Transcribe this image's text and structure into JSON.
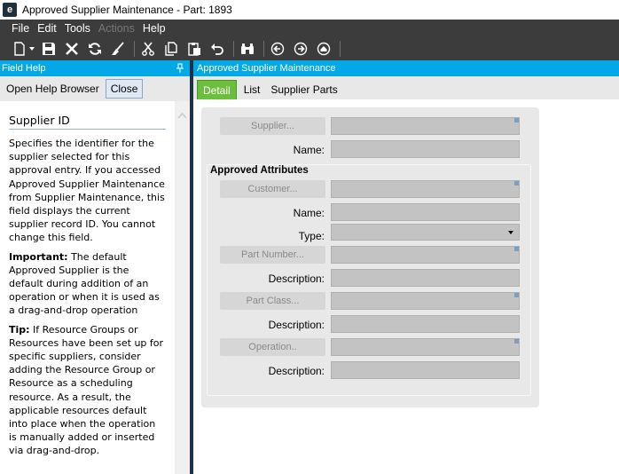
{
  "window": {
    "logo_letter": "e",
    "title": "Approved Supplier Maintenance - Part: 1893"
  },
  "menu": [
    {
      "label": "File",
      "enabled": true
    },
    {
      "label": "Edit",
      "enabled": true
    },
    {
      "label": "Tools",
      "enabled": true
    },
    {
      "label": "Actions",
      "enabled": false
    },
    {
      "label": "Help",
      "enabled": true
    }
  ],
  "toolbar": {
    "icons": [
      "new-icon",
      "save-icon",
      "delete-icon",
      "refresh-icon",
      "clear-icon",
      "cut-icon",
      "copy-icon",
      "paste-icon",
      "undo-icon",
      "search-icon",
      "back-icon",
      "forward-icon",
      "home-icon"
    ]
  },
  "help_panel": {
    "header": "Field Help",
    "open_browser_label": "Open Help Browser",
    "close_label": "Close",
    "topic_title": "Supplier ID",
    "paragraph1": "Specifies the identifier for the supplier selected for this approval entry. If you accessed Approved Supplier Maintenance from Supplier Maintenance, this field displays the current supplier record ID. You cannot change this field.",
    "important_label": "Important:",
    "important_text": " The default Approved Supplier is the default during addition of an operation or when it is used as a drag-and-drop operation",
    "tip_label": "Tip:",
    "tip_text": " If Resource Groups or Resources have been set up for specific suppliers, consider adding the Resource Group or Resource as a scheduling resource. As a result, the applicable resources default into place when the operation is manually added or inserted via drag-and-drop."
  },
  "form": {
    "header": "Approved Supplier Maintenance",
    "tabs": [
      {
        "label": "Detail",
        "active": true
      },
      {
        "label": "List",
        "active": false
      },
      {
        "label": "Supplier Parts",
        "active": false
      }
    ],
    "supplier_button": "Supplier...",
    "name_label": "Name:",
    "group_title": "Approved Attributes",
    "customer_button": "Customer...",
    "customer_name_label": "Name:",
    "type_label": "Type:",
    "part_number_button": "Part Number...",
    "part_description_label": "Description:",
    "part_class_button": "Part Class...",
    "class_description_label": "Description:",
    "operation_button": "Operation..",
    "operation_description_label": "Description:"
  },
  "colors": {
    "panel_header": "#03a9e6",
    "active_tab": "#6cbf3c",
    "menubar": "#3c3c3c"
  }
}
